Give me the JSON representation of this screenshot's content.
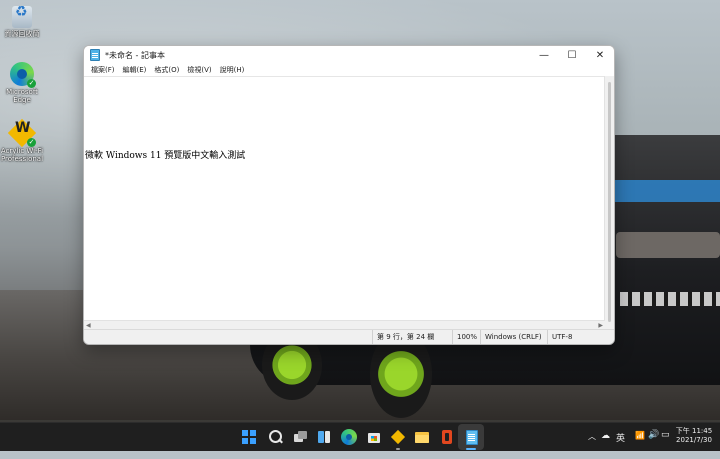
{
  "desktop": {
    "icons": [
      {
        "label": "資源回收筒",
        "icon": "recycle-bin-icon"
      },
      {
        "label": "Microsoft Edge",
        "icon": "edge-icon"
      },
      {
        "label": "Acrylic Wi-Fi Professional",
        "icon": "acrylic-wifi-icon"
      }
    ]
  },
  "notepad": {
    "title": "*未命名 - 記事本",
    "controls": {
      "minimize": "—",
      "maximize": "☐",
      "close": "✕"
    },
    "menu": [
      "檔案(F)",
      "編輯(E)",
      "格式(O)",
      "檢視(V)",
      "說明(H)"
    ],
    "content": "微軟 Windows 11 預覽版中文輸入測試",
    "status": {
      "position": "第 9 行，第 24 欄",
      "zoom": "100%",
      "line_ending": "Windows (CRLF)",
      "encoding": "UTF-8"
    }
  },
  "taskbar": {
    "pinned": [
      "start-icon",
      "search-icon",
      "task-view-icon",
      "widgets-icon",
      "edge-icon",
      "store-icon",
      "acrylic-wifi-icon",
      "file-explorer-icon",
      "office-icon",
      "notepad-icon"
    ],
    "accent": "#57b4ff"
  },
  "tray": {
    "chevron": "︿",
    "cloud": "☁",
    "ime": "英",
    "wifi": "📶",
    "volume": "🔊",
    "battery": "▭",
    "time": "下午 11:45",
    "date": "2021/7/30"
  }
}
